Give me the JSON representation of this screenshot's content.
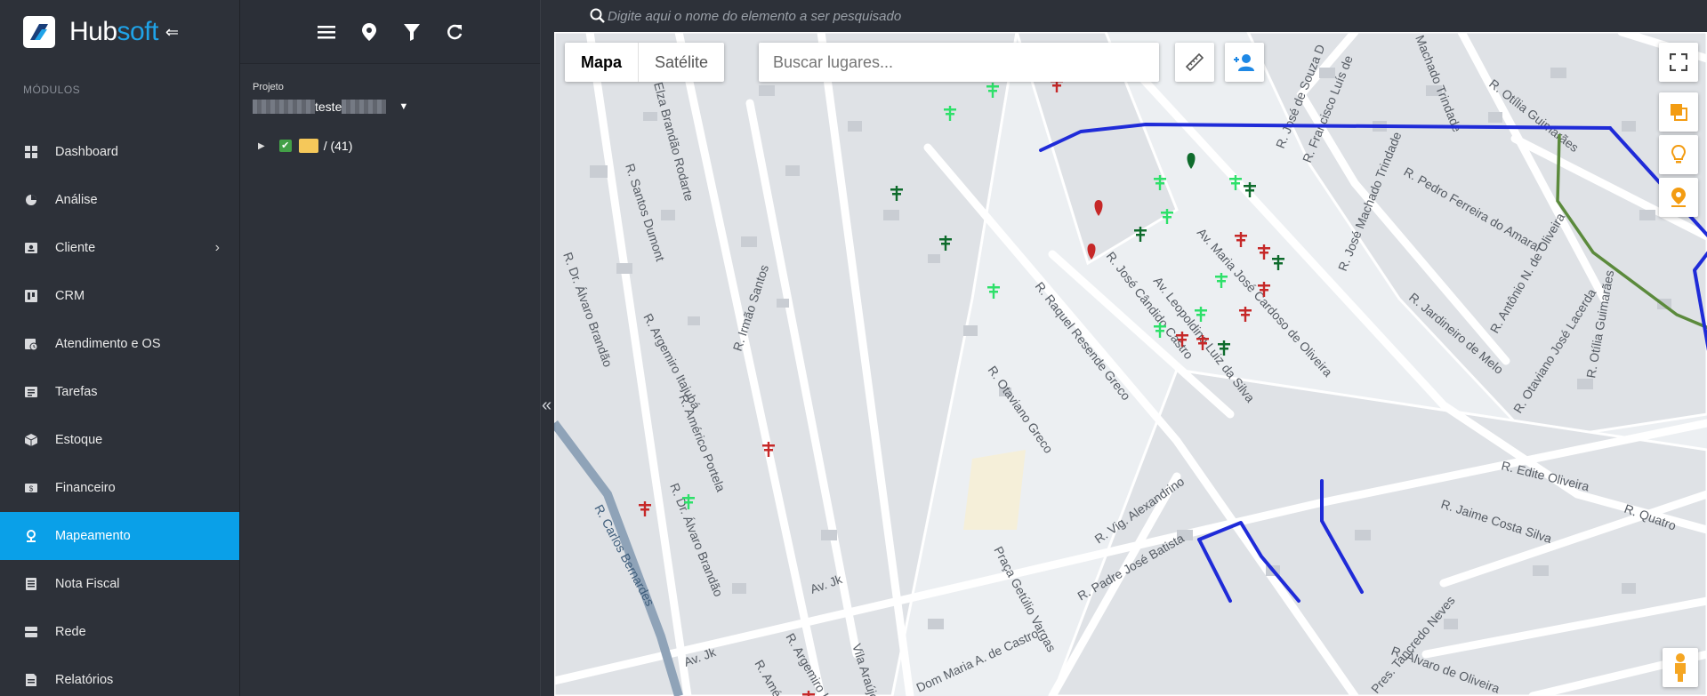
{
  "brand": {
    "name_part1": "Hub",
    "name_part2": "soft",
    "accent": "#0aa0e8"
  },
  "sidebar": {
    "section_label": "MÓDULOS",
    "items": [
      {
        "label": "Dashboard",
        "icon": "grid-icon"
      },
      {
        "label": "Análise",
        "icon": "pie-chart-icon"
      },
      {
        "label": "Cliente",
        "icon": "contact-card-icon",
        "has_submenu": true
      },
      {
        "label": "CRM",
        "icon": "kanban-icon"
      },
      {
        "label": "Atendimento e OS",
        "icon": "calendar-clock-icon"
      },
      {
        "label": "Tarefas",
        "icon": "task-list-icon"
      },
      {
        "label": "Estoque",
        "icon": "box-icon"
      },
      {
        "label": "Financeiro",
        "icon": "money-icon"
      },
      {
        "label": "Mapeamento",
        "icon": "map-pin-icon",
        "active": true
      },
      {
        "label": "Nota Fiscal",
        "icon": "invoice-icon"
      },
      {
        "label": "Rede",
        "icon": "server-icon"
      },
      {
        "label": "Relatórios",
        "icon": "report-icon"
      }
    ]
  },
  "panel": {
    "toolbar_icons": [
      "menu-icon",
      "map-marker-icon",
      "filter-icon",
      "refresh-icon"
    ],
    "project_label": "Projeto",
    "project_value": "teste",
    "tree_root": {
      "label": "/ (41)",
      "checked": true
    }
  },
  "search": {
    "placeholder": "Digite aqui o nome do elemento a ser pesquisado"
  },
  "map": {
    "type_options": [
      "Mapa",
      "Satélite"
    ],
    "selected_type": "Mapa",
    "place_search_placeholder": "Buscar lugares...",
    "street_labels": [
      "Elza Brandão Rodarte",
      "R. Santos Dumont",
      "R. Dr. Álvaro Brandão",
      "R. Argemiro Itajubá",
      "R. Irmão Santos",
      "R. Américo Portela",
      "R. Dr. Álvaro Brandão",
      "R. Carlos Bernardes",
      "Av. Jk",
      "Av. Jk",
      "R. Argemiro Itajubá",
      "R. Américo",
      "Vila Araújo",
      "Dom Maria A. de Castro",
      "Praça Getúlio Vargas",
      "R. Padre José Batista",
      "R. Vig. Alexandrino",
      "R. Otaviano Greco",
      "R. Raquel Resende Greco",
      "R. José Cândido Castro",
      "Av. Leopoldino Luiz da Silva",
      "Av. Maria José Cardoso de Oliveira",
      "R. José de Souza D",
      "R. Francisco Luís de",
      "Machado Trindade",
      "R. José Machado Trindade",
      "R. Otília Guimarães",
      "R. Pedro Ferreira do Amaral",
      "R. Jardineiro de Melo",
      "R. Antônio N. de Oliveira",
      "R. Otaviano José Lacerda",
      "R. Otília Guimarães",
      "R. Edite Oliveira",
      "R. Quatro",
      "R. Jaime Costa Silva",
      "Pres. Tancredo Neves",
      "R. Álvaro de Oliveira"
    ],
    "element_colors": {
      "light_green": "#2ee06a",
      "dark_green": "#0e6b2c",
      "red": "#c62828",
      "route_blue": "#1f2bd8",
      "route_green": "#5b8a3c"
    }
  }
}
